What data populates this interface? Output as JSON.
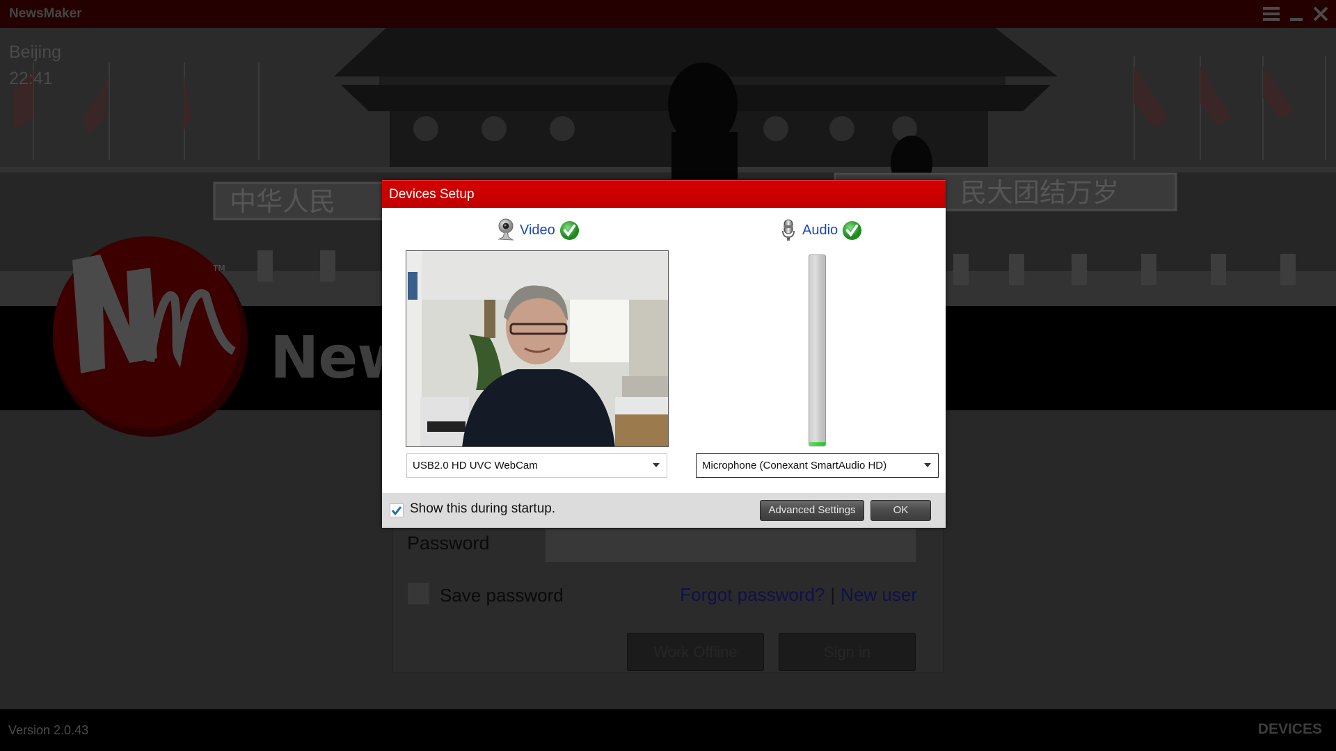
{
  "app": {
    "title": "NewsMaker",
    "window_controls": [
      "menu-icon",
      "minimize-icon",
      "close-icon"
    ]
  },
  "hero": {
    "city": "Beijing",
    "time": "22:41",
    "banner_left": "中华人民",
    "banner_right": "民大团结万岁",
    "brand_text": "News",
    "logo_text": "Nm",
    "logo_tm": "TM"
  },
  "login": {
    "password_label": "Password",
    "password_value": "",
    "save_password_label": "Save password",
    "save_password_checked": false,
    "forgot_link": "Forgot password?",
    "separator": "|",
    "new_user_link": "New user",
    "work_offline_button": "Work Offline",
    "sign_in_button": "Sign in"
  },
  "footer": {
    "version": "Version 2.0.43",
    "devices_link": "DEVICES"
  },
  "dialog": {
    "title": "Devices Setup",
    "video": {
      "label": "Video",
      "icon": "webcam-icon",
      "status_icon": "check-icon",
      "status": "ok",
      "selected_device": "USB2.0 HD UVC WebCam"
    },
    "audio": {
      "label": "Audio",
      "icon": "microphone-icon",
      "status_icon": "check-icon",
      "status": "ok",
      "level_percent": 2,
      "selected_device": "Microphone (Conexant SmartAudio HD)"
    },
    "show_on_startup_label": "Show this during startup.",
    "show_on_startup_checked": true,
    "advanced_settings_button": "Advanced Settings",
    "ok_button": "OK"
  },
  "colors": {
    "dialog_header": "#c80000",
    "link_blue": "#1a47b8",
    "check_green": "#2ea52e",
    "meter_green": "#33cc33",
    "titlebar": "#240000"
  }
}
